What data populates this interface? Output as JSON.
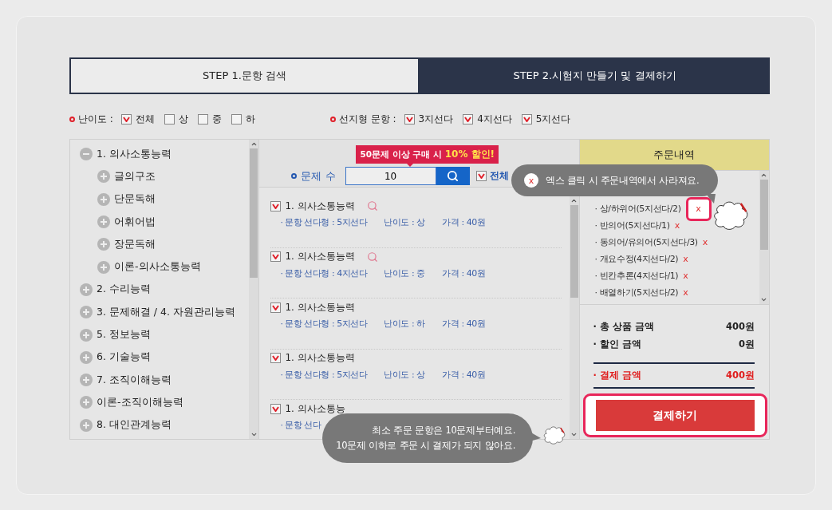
{
  "tabs": [
    {
      "label": "STEP 1.문항 검색",
      "selected": false
    },
    {
      "label": "STEP 2.시험지 만들기 및 결제하기",
      "selected": true
    }
  ],
  "filters": [
    {
      "label": "난이도 :",
      "options": [
        {
          "label": "전체",
          "checked": true
        },
        {
          "label": "상",
          "checked": false
        },
        {
          "label": "중",
          "checked": false
        },
        {
          "label": "하",
          "checked": false
        }
      ]
    },
    {
      "label": "선지형 문항 :",
      "options": [
        {
          "label": "3지선다",
          "checked": true
        },
        {
          "label": "4지선다",
          "checked": true
        },
        {
          "label": "5지선다",
          "checked": true
        }
      ]
    }
  ],
  "category_tree": [
    {
      "label": "1. 의사소통능력",
      "expanded": true,
      "children": [
        {
          "label": "글의구조",
          "expanded": false
        },
        {
          "label": "단문독해",
          "expanded": false
        },
        {
          "label": "어휘어법",
          "expanded": false
        },
        {
          "label": "장문독해",
          "expanded": false
        },
        {
          "label": "이론-의사소통능력",
          "expanded": false
        }
      ]
    },
    {
      "label": "2. 수리능력",
      "expanded": false
    },
    {
      "label": "3. 문제해결 / 4. 자원관리능력",
      "expanded": false
    },
    {
      "label": "5. 정보능력",
      "expanded": false
    },
    {
      "label": "6. 기술능력",
      "expanded": false
    },
    {
      "label": "7. 조직이해능력",
      "expanded": false
    },
    {
      "label": "이론-조직이해능력",
      "expanded": false
    },
    {
      "label": "8. 대인관계능력",
      "expanded": false
    }
  ],
  "search": {
    "promo": {
      "text": "50문제 이상 구매 시",
      "highlight": "10% 할인!"
    },
    "label": "문제 수",
    "value": "10",
    "all": {
      "label": "전체",
      "checked": true
    }
  },
  "questions": [
    {
      "title": "1. 의사소통능력",
      "checked": true,
      "preview": true,
      "type": "· 문항 선다형 : 5지선다",
      "difficulty": "난이도 : 상",
      "price": "가격 : 40원"
    },
    {
      "title": "1. 의사소통능력",
      "checked": true,
      "preview": true,
      "type": "· 문항 선다형 : 4지선다",
      "difficulty": "난이도 : 중",
      "price": "가격 : 40원"
    },
    {
      "title": "1. 의사소통능력",
      "checked": true,
      "preview": false,
      "type": "· 문항 선다형 : 5지선다",
      "difficulty": "난이도 : 하",
      "price": "가격 : 40원"
    },
    {
      "title": "1. 의사소통능력",
      "checked": true,
      "preview": false,
      "type": "· 문항 선다형 : 5지선다",
      "difficulty": "난이도 : 상",
      "price": "가격 : 40원"
    },
    {
      "title": "1. 의사소통능",
      "checked": true,
      "preview": false,
      "type": "· 문항 선다"
    }
  ],
  "order": {
    "title": "주문내역",
    "items": [
      {
        "label": "· 상/하위어(5지선다/2)",
        "remove": "x",
        "highlighted": true
      },
      {
        "label": "· 반의어(5지선다/1)",
        "remove": "x",
        "highlighted": false
      },
      {
        "label": "· 동의어/유의어(5지선다/3)",
        "remove": "x",
        "highlighted": false
      },
      {
        "label": "· 개요수정(4지선다/2)",
        "remove": "x",
        "highlighted": false
      },
      {
        "label": "· 빈칸추론(4지선다/1)",
        "remove": "x",
        "highlighted": false
      },
      {
        "label": "· 배열하기(5지선다/2)",
        "remove": "x",
        "highlighted": false
      }
    ],
    "summary": [
      {
        "label": "· 총 상품 금액",
        "value": "400원",
        "kind": "normal"
      },
      {
        "label": "· 할인 금액",
        "value": "0원",
        "kind": "normal"
      },
      {
        "label": "· 결제 금액",
        "value": "400원",
        "kind": "total"
      }
    ],
    "pay_button": "결제하기"
  },
  "tips": [
    {
      "icon": "x",
      "lines": [
        "엑스 클릭 시 주문내역에서 사라져요."
      ]
    },
    {
      "lines": [
        "최소 주문 문항은 10문제부터예요.",
        "10문제 이하로 주문 시 결제가 되지 않아요."
      ]
    }
  ]
}
